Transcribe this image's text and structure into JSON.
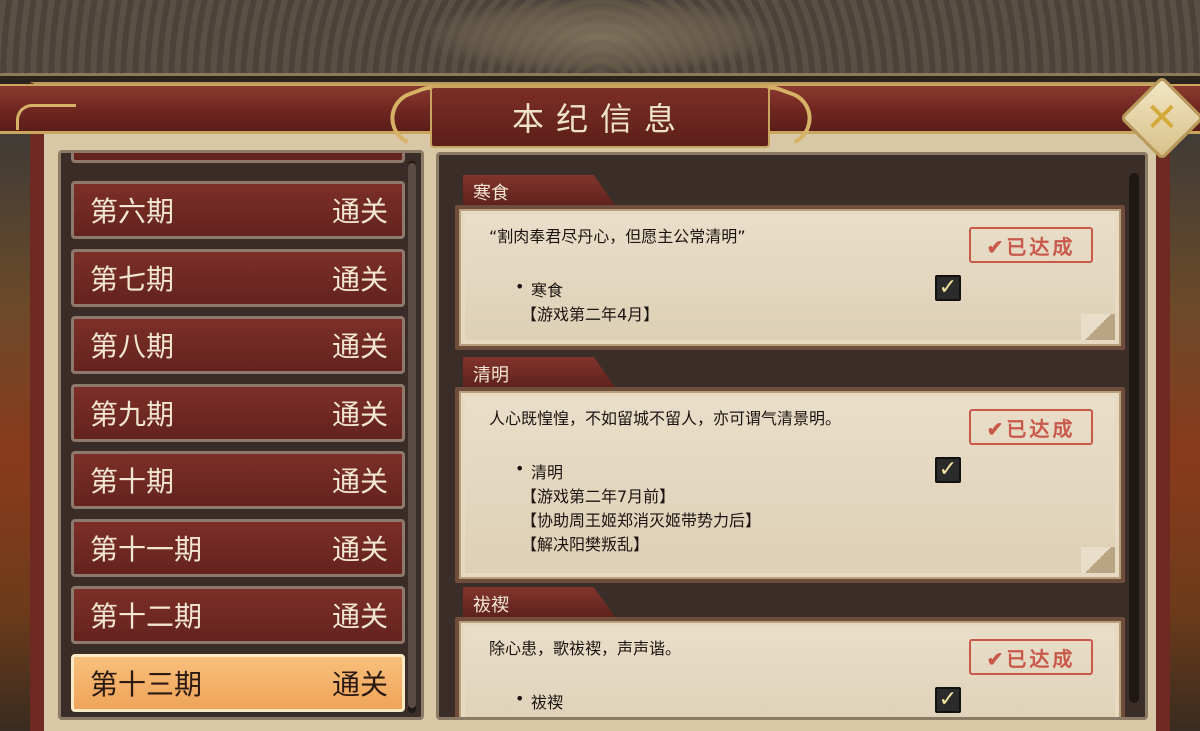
{
  "window": {
    "title": "本纪信息"
  },
  "periods": [
    {
      "label": "第六期",
      "status": "通关",
      "active": false
    },
    {
      "label": "第七期",
      "status": "通关",
      "active": false
    },
    {
      "label": "第八期",
      "status": "通关",
      "active": false
    },
    {
      "label": "第九期",
      "status": "通关",
      "active": false
    },
    {
      "label": "第十期",
      "status": "通关",
      "active": false
    },
    {
      "label": "第十一期",
      "status": "通关",
      "active": false
    },
    {
      "label": "第十二期",
      "status": "通关",
      "active": false
    },
    {
      "label": "第十三期",
      "status": "通关",
      "active": true
    }
  ],
  "festivals": [
    {
      "name": "寒食",
      "quote": "“割肉奉君尽丹心，但愿主公常清明”",
      "stamp": "✔已达成",
      "condition": "寒食",
      "requirements": [
        "【游戏第二年4月】"
      ],
      "checked": true
    },
    {
      "name": "清明",
      "quote": "人心既惶惶，不如留城不留人，亦可谓气清景明。",
      "stamp": "✔已达成",
      "condition": "清明",
      "requirements": [
        "【游戏第二年7月前】",
        "【协助周王姬郑消灭姬带势力后】",
        "【解决阳樊叛乱】"
      ],
      "checked": true
    },
    {
      "name": "祓禊",
      "quote": "除心患，歌祓禊，声声谐。",
      "stamp": "✔已达成",
      "condition": "祓禊",
      "requirements": [],
      "checked": true
    }
  ],
  "icons": {
    "close": "close-icon",
    "check": "check-icon"
  },
  "colors": {
    "accent_red": "#6f2620",
    "gold": "#c9a560",
    "active_item": "#f0a35a",
    "stamp": "#c8594b"
  }
}
